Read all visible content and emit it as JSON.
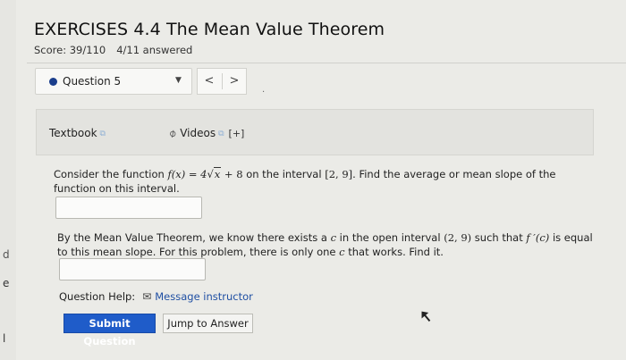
{
  "header": {
    "title": "EXERCISES 4.4 The Mean Value Theorem",
    "score_label": "Score: 39/110",
    "answered_label": "4/11 answered"
  },
  "question_nav": {
    "selected": "Question 5",
    "prev_label": "<",
    "next_label": ">"
  },
  "resources": {
    "textbook_label": "Textbook",
    "videos_label": "Videos",
    "plus_label": "[+]"
  },
  "problem1": {
    "text_before": "Consider the function ",
    "fx": "f(x) = 4",
    "radicand": "x",
    "after_sqrt": " + 8",
    "interval_text": " on the interval ",
    "interval": "[2, 9]",
    "text_after": ". Find the average or mean slope of the function on this interval."
  },
  "problem2": {
    "text_a": "By the Mean Value Theorem, we know there exists a ",
    "c1": "c",
    "text_b": " in the open interval ",
    "interval": "(2, 9)",
    "text_c": " such that ",
    "fpc": "f ′(c)",
    "text_d": " is equal to this mean slope. For this problem, there is only one ",
    "c2": "c",
    "text_e": " that works. Find it."
  },
  "help": {
    "label": "Question Help:",
    "link": "Message instructor"
  },
  "buttons": {
    "submit": "Submit Question",
    "jump": "Jump to Answer"
  },
  "edge_marks": [
    "d",
    "e",
    "l"
  ],
  "icons": {
    "question_status": "filled-circle-icon",
    "dropdown": "caret-down-icon",
    "external_link": "external-link-icon",
    "video": "paperclip-icon",
    "mail": "envelope-icon",
    "cursor": "mouse-pointer-icon"
  },
  "colors": {
    "accent": "#1f5cc9",
    "status_dot": "#1a3e8c",
    "link": "#1f4fa3"
  }
}
